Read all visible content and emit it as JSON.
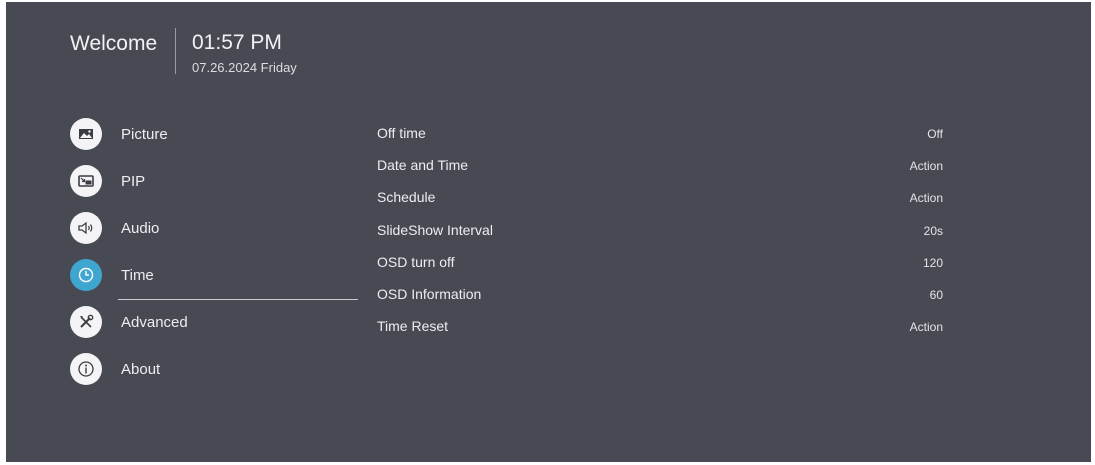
{
  "header": {
    "welcome": "Welcome",
    "time": "01:57 PM",
    "date": "07.26.2024 Friday"
  },
  "menu": {
    "items": [
      {
        "label": "Picture",
        "icon": "picture-icon"
      },
      {
        "label": "PIP",
        "icon": "pip-icon"
      },
      {
        "label": "Audio",
        "icon": "audio-icon"
      },
      {
        "label": "Time",
        "icon": "clock-icon",
        "active": true
      },
      {
        "label": "Advanced",
        "icon": "tools-icon"
      },
      {
        "label": "About",
        "icon": "info-icon"
      }
    ]
  },
  "settings": {
    "rows": [
      {
        "label": "Off time",
        "value": "Off"
      },
      {
        "label": "Date and Time",
        "value": "Action"
      },
      {
        "label": "Schedule",
        "value": "Action"
      },
      {
        "label": "SlideShow Interval",
        "value": "20s"
      },
      {
        "label": "OSD turn off",
        "value": "120"
      },
      {
        "label": "OSD Information",
        "value": "60"
      },
      {
        "label": "Time Reset",
        "value": "Action"
      }
    ]
  },
  "colors": {
    "background": "#484a53",
    "accent": "#3fa6cf",
    "text": "#e9eaee"
  }
}
